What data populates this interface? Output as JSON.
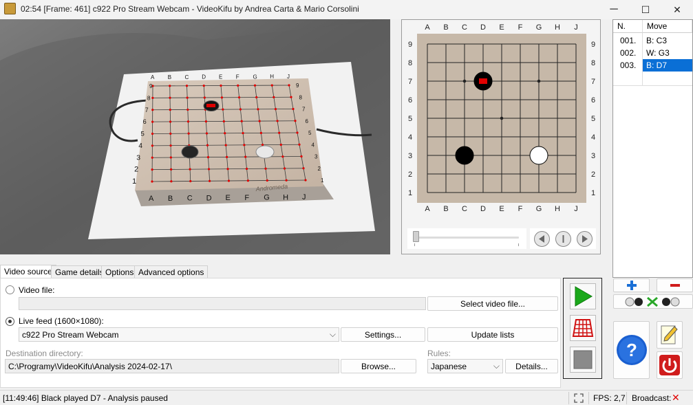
{
  "window": {
    "title": "02:54 [Frame: 461] c922 Pro Stream Webcam - VideoKifu by Andrea Carta & Mario Corsolini",
    "minimize_glyph": "─",
    "maximize_glyph": "☐",
    "close_glyph": "✕"
  },
  "board": {
    "columns": [
      "A",
      "B",
      "C",
      "D",
      "E",
      "F",
      "G",
      "H",
      "J"
    ],
    "rows": [
      "9",
      "8",
      "7",
      "6",
      "5",
      "4",
      "3",
      "2",
      "1"
    ],
    "stones": [
      {
        "color": "black",
        "col": "C",
        "row": 3,
        "last": false
      },
      {
        "color": "white",
        "col": "G",
        "row": 3,
        "last": false
      },
      {
        "color": "black",
        "col": "D",
        "row": 7,
        "last": true
      }
    ],
    "colors": {
      "board": "#c6b8a8",
      "last_move_marker": "#e00000"
    }
  },
  "webcam": {
    "signature": "Andromeda",
    "columns": [
      "A",
      "B",
      "C",
      "D",
      "E",
      "F",
      "G",
      "H",
      "J"
    ],
    "rows": [
      "9",
      "8",
      "7",
      "6",
      "5",
      "4",
      "3",
      "2",
      "1"
    ]
  },
  "moves": {
    "headers": {
      "number": "N.",
      "move": "Move"
    },
    "rows": [
      {
        "n": "001.",
        "move": "B: C3",
        "selected": false
      },
      {
        "n": "002.",
        "move": "W: G3",
        "selected": false
      },
      {
        "n": "003.",
        "move": "B: D7",
        "selected": true
      }
    ],
    "selection_color": "#0a6fd6"
  },
  "tabs": [
    {
      "label": "Video source",
      "active": true
    },
    {
      "label": "Game details",
      "active": false
    },
    {
      "label": "Options",
      "active": false
    },
    {
      "label": "Advanced options",
      "active": false
    }
  ],
  "video_source": {
    "video_file_label": "Video file:",
    "select_video_label": "Select video file...",
    "live_feed_label": "Live feed (1600×1080):",
    "camera_value": "c922 Pro Stream Webcam",
    "settings_label": "Settings...",
    "update_lists_label": "Update lists",
    "destination_label": "Destination directory:",
    "destination_value": "C:\\Programy\\VideoKifu\\Analysis 2024-02-17\\",
    "browse_label": "Browse...",
    "rules_label": "Rules:",
    "rules_value": "Japanese",
    "details_label": "Details..."
  },
  "status": {
    "message": "[11:49:46] Black played D7 - Analysis paused",
    "fps": "FPS: 2,7",
    "broadcast": "Broadcast:",
    "broadcast_state_glyph": "✕"
  },
  "icons": {
    "play_color": "#1aa81a",
    "grid_color": "#d01010",
    "stop_color": "#8a8a8a",
    "help_color": "#1a5fd0",
    "power_color": "#d01c1c"
  }
}
